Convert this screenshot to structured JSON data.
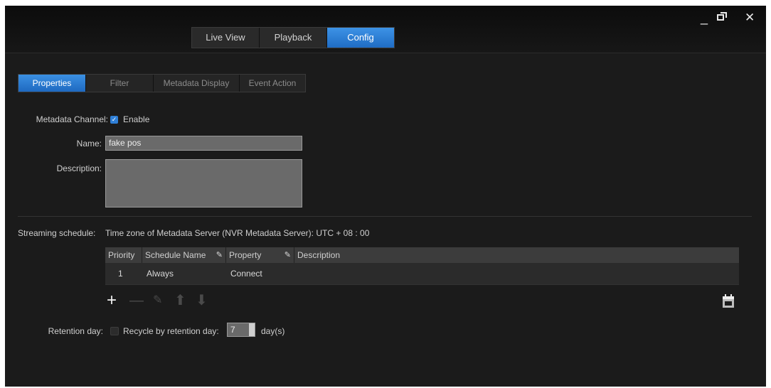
{
  "window_controls": {
    "minimize": "_",
    "restore": "□",
    "close": "✕"
  },
  "main_tabs": [
    "Live View",
    "Playback",
    "Config"
  ],
  "sub_tabs": [
    "Properties",
    "Filter",
    "Metadata Display",
    "Event Action"
  ],
  "form": {
    "metadata_channel_label": "Metadata Channel:",
    "enable_label": "Enable",
    "name_label": "Name:",
    "name_value": "fake pos",
    "description_label": "Description:",
    "description_value": ""
  },
  "schedule": {
    "label": "Streaming schedule:",
    "timezone": "Time zone of Metadata Server (NVR Metadata Server): UTC + 08 : 00",
    "columns": [
      "Priority",
      "Schedule Name",
      "Property",
      "Description"
    ],
    "rows": [
      {
        "priority": "1",
        "name": "Always",
        "property": "Connect",
        "description": ""
      }
    ]
  },
  "toolbar_icons": [
    "plus-icon",
    "minus-icon",
    "pencil-icon",
    "arrow-up-icon",
    "arrow-down-icon",
    "calendar-icon"
  ],
  "retention": {
    "label": "Retention day:",
    "checkbox_label": "Recycle by retention day:",
    "value": "7",
    "unit": "day(s)"
  },
  "colors": {
    "accent": "#2f7fd6",
    "background": "#1b1b1b"
  }
}
